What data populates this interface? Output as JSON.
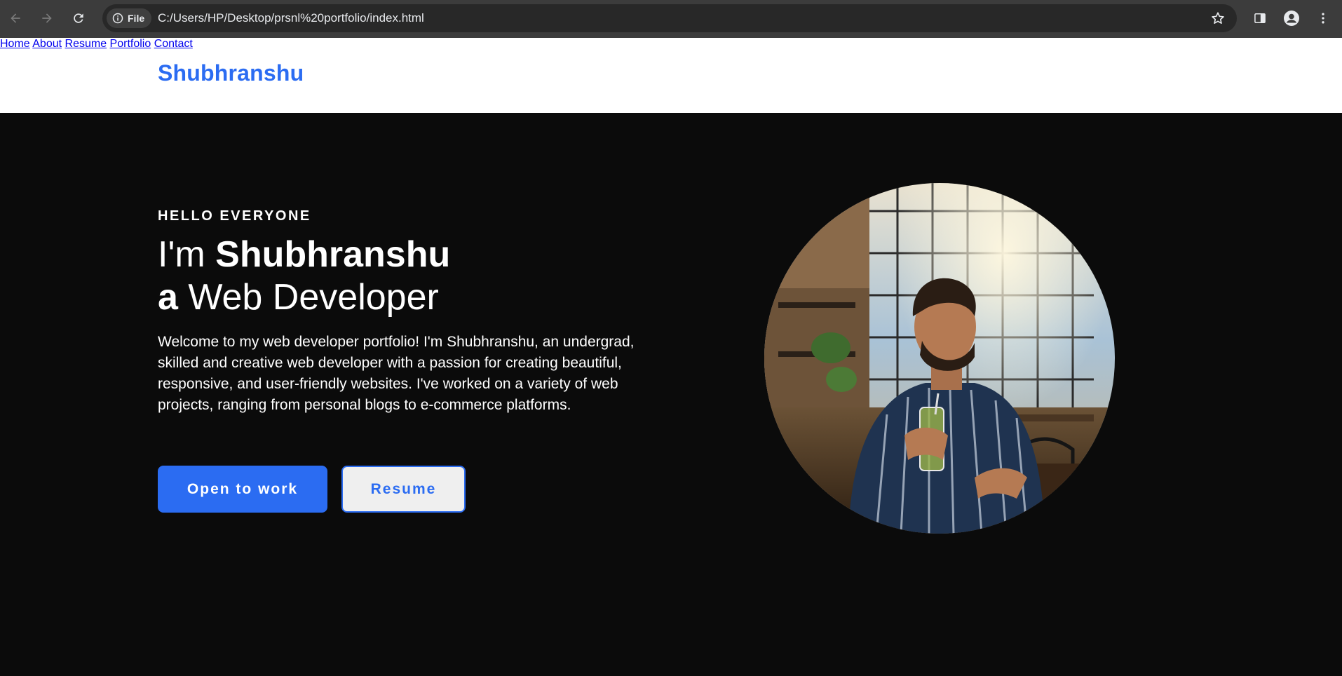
{
  "browser": {
    "chip_label": "File",
    "url": "C:/Users/HP/Desktop/prsnl%20portfolio/index.html",
    "icons": [
      "back-icon",
      "forward-icon",
      "reload-icon",
      "info-icon",
      "star-icon",
      "sidepanel-icon",
      "profile-icon",
      "menu-dots-icon"
    ]
  },
  "site": {
    "logo": "Shubhranshu",
    "nav": [
      {
        "label": "Home"
      },
      {
        "label": "About"
      },
      {
        "label": "Resume"
      },
      {
        "label": "Portfolio"
      },
      {
        "label": "Contact"
      }
    ]
  },
  "hero": {
    "eyebrow": "HELLO EVERYONE",
    "line1_prefix": "I'm ",
    "line1_name": "Shubhranshu",
    "line2_bold": "a",
    "line2_rest": " Web Developer",
    "intro": "Welcome to my web developer portfolio! I'm Shubhranshu, an undergrad, skilled and creative web developer with a passion for creating beautiful, responsive, and user-friendly websites. I've worked on a variety of web projects, ranging from personal blogs to e-commerce platforms.",
    "primary_button": "Open to work",
    "secondary_button": "Resume"
  },
  "colors": {
    "accent": "#2b6cf2",
    "hero_bg": "#0b0b0b",
    "header_bg": "#ffffff",
    "chrome_bg": "#3c3c3c"
  }
}
